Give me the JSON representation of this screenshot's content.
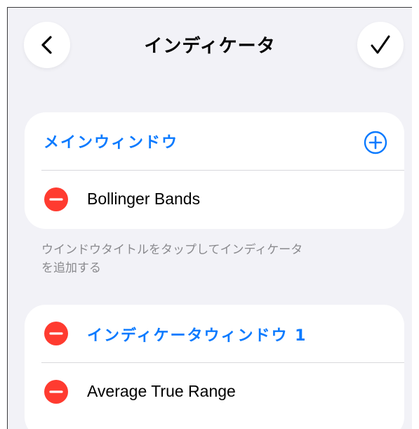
{
  "nav": {
    "back_icon": "chevron-left-icon",
    "title": "インディケータ",
    "done_icon": "checkmark-icon"
  },
  "main_window": {
    "title": "メインウィンドウ",
    "add_icon": "plus-circle-icon",
    "indicators": [
      {
        "label": "Bollinger Bands",
        "remove_icon": "minus-circle-icon"
      }
    ]
  },
  "footer": {
    "line1": "ウインドウタイトルをタップしてインディケータ",
    "line2": "を追加する"
  },
  "indicator_window_1": {
    "title": "インディケータウィンドウ 1",
    "remove_icon": "minus-circle-icon",
    "indicators": [
      {
        "label": "Average True Range",
        "remove_icon": "minus-circle-icon"
      }
    ]
  },
  "colors": {
    "accent": "#0a7aff",
    "destructive": "#ff3b30",
    "background": "#f2f2f7",
    "card": "#ffffff",
    "secondary_text": "#8a8a8e"
  }
}
